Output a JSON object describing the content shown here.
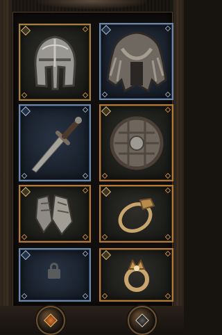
{
  "slots": [
    {
      "name": "helmet",
      "frame": "gold"
    },
    {
      "name": "cape",
      "frame": "blue"
    },
    {
      "name": "dagger",
      "frame": "blue"
    },
    {
      "name": "shield",
      "frame": "orange"
    },
    {
      "name": "gloves",
      "frame": "orange"
    },
    {
      "name": "ring",
      "frame": "orange"
    },
    {
      "name": "locked-slot",
      "frame": "blue"
    },
    {
      "name": "crown-ring",
      "frame": "orange"
    }
  ],
  "colors": {
    "gold_frame": "#a7823e",
    "blue_frame": "#6d88a9",
    "orange_frame": "#b67a34"
  },
  "bottom_buttons": [
    {
      "icon": "orange-diamond-icon"
    },
    {
      "icon": "silver-diamond-icon"
    }
  ]
}
